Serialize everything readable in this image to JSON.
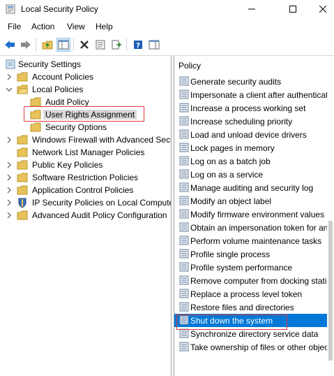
{
  "window": {
    "title": "Local Security Policy"
  },
  "menu": [
    "File",
    "Action",
    "View",
    "Help"
  ],
  "toolbar": {
    "buttons": [
      "back-arrow-icon",
      "forward-arrow-icon",
      "up-folder-icon",
      "show-hide-tree-icon",
      "delete-icon",
      "properties-icon",
      "export-list-icon",
      "help-icon",
      "console-pane-icon"
    ]
  },
  "tree": {
    "root": "Security Settings",
    "account_policies": "Account Policies",
    "local_policies": "Local Policies",
    "audit_policy": "Audit Policy",
    "user_rights": "User Rights Assignment",
    "security_options": "Security Options",
    "windows_firewall": "Windows Firewall with Advanced Secu",
    "network_list": "Network List Manager Policies",
    "public_key": "Public Key Policies",
    "software_restriction": "Software Restriction Policies",
    "app_control": "Application Control Policies",
    "ip_security": "IP Security Policies on Local Compute",
    "advanced_audit": "Advanced Audit Policy Configuration"
  },
  "policy": {
    "header": "Policy",
    "items": [
      "Generate security audits",
      "Impersonate a client after authenticat",
      "Increase a process working set",
      "Increase scheduling priority",
      "Load and unload device drivers",
      "Lock pages in memory",
      "Log on as a batch job",
      "Log on as a service",
      "Manage auditing and security log",
      "Modify an object label",
      "Modify firmware environment values",
      "Obtain an impersonation token for an",
      "Perform volume maintenance tasks",
      "Profile single process",
      "Profile system performance",
      "Remove computer from docking stati",
      "Replace a process level token",
      "Restore files and directories",
      "Shut down the system",
      "Synchronize directory service data",
      "Take ownership of files or other objec"
    ],
    "selected_index": 18
  },
  "colors": {
    "selection": "#0078d7",
    "highlight_box": "#e0393e",
    "folder": "#e8c25a"
  }
}
